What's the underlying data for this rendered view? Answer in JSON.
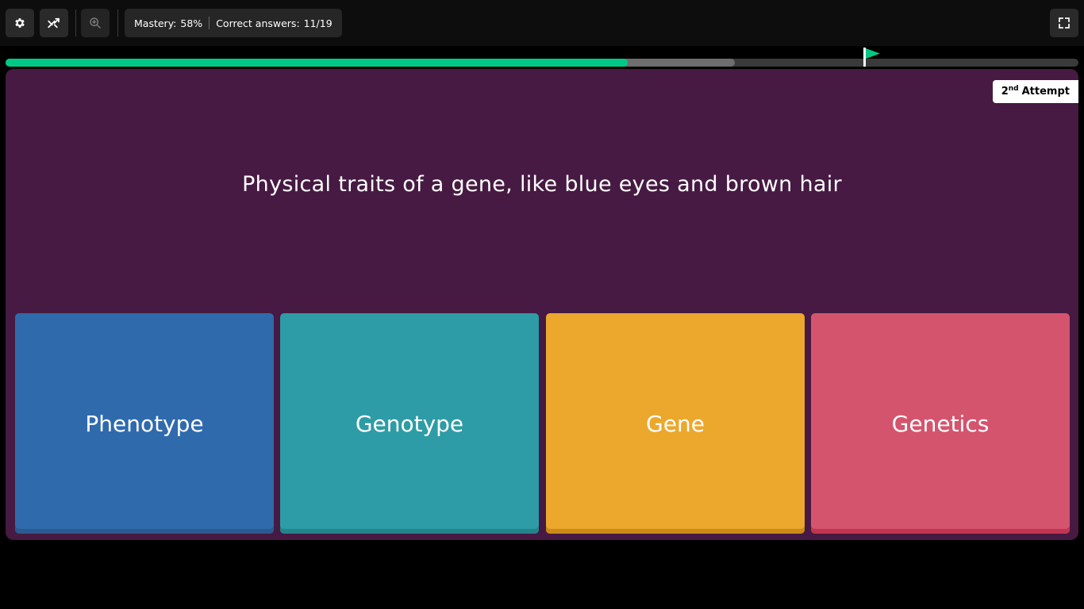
{
  "toolbar": {
    "settings_icon": "gear-icon",
    "powerup_icon": "shuffle-icon",
    "zoom_icon": "zoom-in-icon",
    "fullscreen_icon": "fullscreen-icon"
  },
  "stats": {
    "mastery_label": "Mastery:",
    "mastery_value": "58%",
    "correct_label": "Correct answers:",
    "correct_value": "11/19"
  },
  "progress": {
    "correct_fraction": 0.58,
    "attempted_fraction": 0.68,
    "flag_fraction": 0.8,
    "colors": {
      "correct": "#00c985",
      "attempted": "#6e6e6e",
      "track": "#3a3a3a",
      "flag": "#00c985"
    }
  },
  "attempt": {
    "number": "2",
    "suffix": "nd",
    "label": "Attempt"
  },
  "question": {
    "text": "Physical traits of a gene, like blue eyes and brown hair"
  },
  "options": [
    {
      "label": "Phenotype",
      "color": "#2f6aad",
      "shade": "#2a5a8f"
    },
    {
      "label": "Genotype",
      "color": "#2d9ca6",
      "shade": "#25838b"
    },
    {
      "label": "Gene",
      "color": "#eca82c",
      "shade": "#c98a1b"
    },
    {
      "label": "Genetics",
      "color": "#d5546d",
      "shade": "#c0364f"
    }
  ],
  "card_color": "#461a42"
}
